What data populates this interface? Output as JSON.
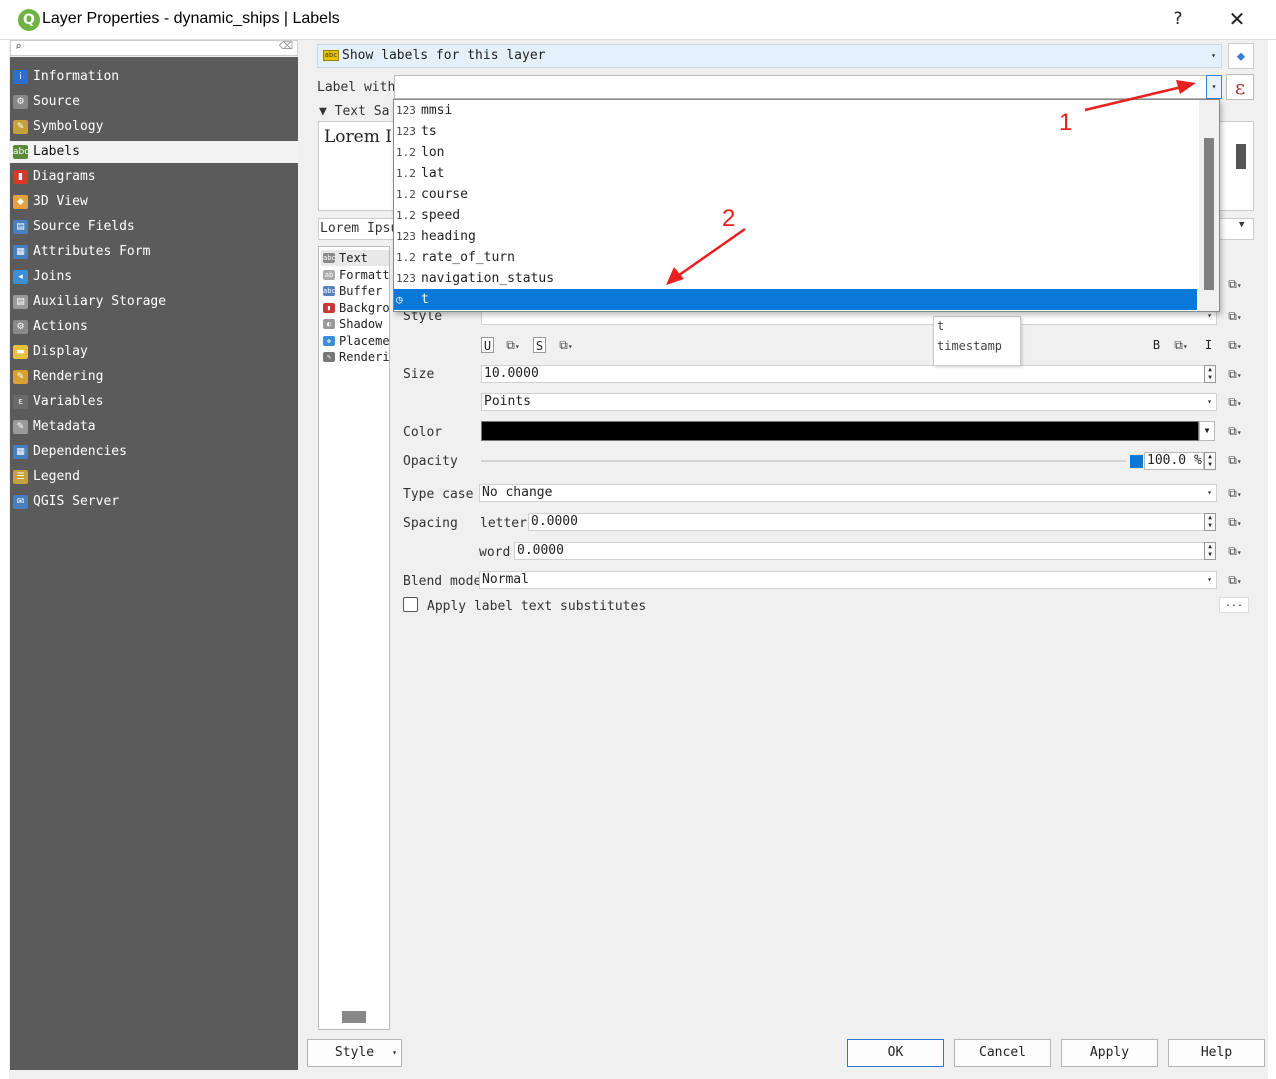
{
  "window": {
    "title": "Layer Properties - dynamic_ships | Labels",
    "app_icon_letter": "Q",
    "help_label": "?",
    "close_label": "✕"
  },
  "sidebar": {
    "search_placeholder": "",
    "items": [
      {
        "label": "Information",
        "icon": "information-icon",
        "color": "#2b6fd6",
        "glyph": "i"
      },
      {
        "label": "Source",
        "icon": "source-icon",
        "color": "#888888",
        "glyph": "⚙"
      },
      {
        "label": "Symbology",
        "icon": "symbology-icon",
        "color": "#c4a13a",
        "glyph": "✎"
      },
      {
        "label": "Labels",
        "icon": "labels-icon",
        "color": "#5a8a3a",
        "glyph": "abc"
      },
      {
        "label": "Diagrams",
        "icon": "diagrams-icon",
        "color": "#d33a2a",
        "glyph": "▮"
      },
      {
        "label": "3D View",
        "icon": "3d-view-icon",
        "color": "#e6a23c",
        "glyph": "◆"
      },
      {
        "label": "Source Fields",
        "icon": "source-fields-icon",
        "color": "#4a7fbf",
        "glyph": "▤"
      },
      {
        "label": "Attributes Form",
        "icon": "attributes-form-icon",
        "color": "#4a7fbf",
        "glyph": "▦"
      },
      {
        "label": "Joins",
        "icon": "joins-icon",
        "color": "#3a8fd6",
        "glyph": "◂"
      },
      {
        "label": "Auxiliary Storage",
        "icon": "auxiliary-storage-icon",
        "color": "#9a9a9a",
        "glyph": "▤"
      },
      {
        "label": "Actions",
        "icon": "actions-icon",
        "color": "#8a8a8a",
        "glyph": "⚙"
      },
      {
        "label": "Display",
        "icon": "display-icon",
        "color": "#e6c23c",
        "glyph": "▬"
      },
      {
        "label": "Rendering",
        "icon": "rendering-icon",
        "color": "#d8a030",
        "glyph": "✎"
      },
      {
        "label": "Variables",
        "icon": "variables-icon",
        "color": "#6a6a6a",
        "glyph": "ε"
      },
      {
        "label": "Metadata",
        "icon": "metadata-icon",
        "color": "#9a9a9a",
        "glyph": "✎"
      },
      {
        "label": "Dependencies",
        "icon": "dependencies-icon",
        "color": "#4a7fbf",
        "glyph": "▦"
      },
      {
        "label": "Legend",
        "icon": "legend-icon",
        "color": "#c4a13a",
        "glyph": "☰"
      },
      {
        "label": "QGIS Server",
        "icon": "qgis-server-icon",
        "color": "#4a7fbf",
        "glyph": "✉"
      }
    ]
  },
  "main": {
    "mode": {
      "label": "Show labels for this layer",
      "icon_text": "abc"
    },
    "label_with": "Label with",
    "text_sample_header": "▼ Text Sa",
    "sample_text": "Lorem I",
    "sample_bar_text": "Lorem Ipsu",
    "tabs": [
      {
        "label": "Text",
        "icon": "text-tab-icon",
        "color": "#888888",
        "glyph": "abc"
      },
      {
        "label": "Formatt",
        "icon": "formatting-tab-icon",
        "color": "#aaaaaa",
        "glyph": "ab"
      },
      {
        "label": "Buffer",
        "icon": "buffer-tab-icon",
        "color": "#5a7fbf",
        "glyph": "abc"
      },
      {
        "label": "Backgro",
        "icon": "background-tab-icon",
        "color": "#c33a3a",
        "glyph": "▮"
      },
      {
        "label": "Shadow",
        "icon": "shadow-tab-icon",
        "color": "#999999",
        "glyph": "◐"
      },
      {
        "label": "Placeme",
        "icon": "placement-tab-icon",
        "color": "#3a8fd6",
        "glyph": "✥"
      },
      {
        "label": "Renderi",
        "icon": "rendering-tab-icon",
        "color": "#777777",
        "glyph": "✎"
      }
    ],
    "style_label": "Style",
    "size_label": "Size",
    "size_value": "10.0000",
    "unit_value": "Points",
    "color_label": "Color",
    "color_value": "#000000",
    "opacity_label": "Opacity",
    "opacity_value": "100.0 %",
    "type_case_label": "Type case",
    "type_case_value": "No change",
    "spacing_label": "Spacing",
    "letter_label": "letter",
    "letter_value": "0.0000",
    "word_label": "word",
    "word_value": "0.0000",
    "blend_label": "Blend mode",
    "blend_value": "Normal",
    "substitutes_label": "Apply label text substitutes",
    "dots_label": "...",
    "fmt": {
      "underline": "U",
      "strike": "S",
      "bold": "B",
      "italic": "I"
    },
    "tooltip": {
      "line1": "t",
      "line2": "timestamp"
    }
  },
  "dropdown": {
    "items": [
      {
        "type": "123",
        "name": "mmsi"
      },
      {
        "type": "123",
        "name": "ts"
      },
      {
        "type": "1.2",
        "name": "lon"
      },
      {
        "type": "1.2",
        "name": "lat"
      },
      {
        "type": "1.2",
        "name": "course"
      },
      {
        "type": "1.2",
        "name": "speed"
      },
      {
        "type": "123",
        "name": "heading"
      },
      {
        "type": "1.2",
        "name": "rate_of_turn"
      },
      {
        "type": "123",
        "name": "navigation_status"
      },
      {
        "type": "◷",
        "name": "t"
      }
    ],
    "selected_index": 9
  },
  "annotations": {
    "one": "1",
    "two": "2",
    "color": "#e8201f"
  },
  "buttons": {
    "style": "Style",
    "ok": "OK",
    "cancel": "Cancel",
    "apply": "Apply",
    "help": "Help"
  }
}
